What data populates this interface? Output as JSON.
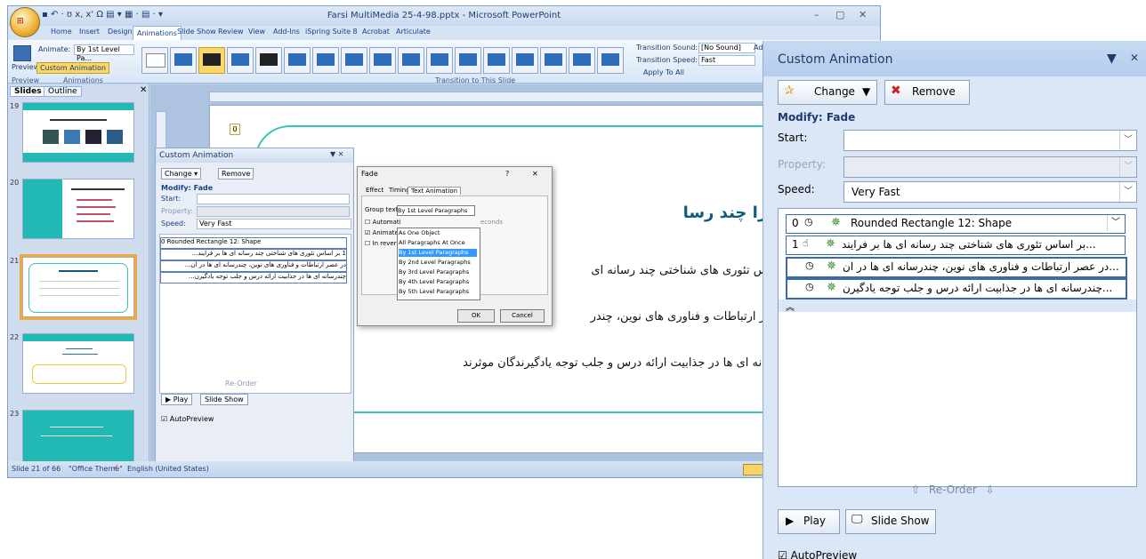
{
  "window": {
    "title": "Farsi MultiMedia 25-4-98.pptx - Microsoft PowerPoint",
    "tabs": [
      "Home",
      "Insert",
      "Design",
      "Animations",
      "Slide Show",
      "Review",
      "View",
      "Add-Ins",
      "iSpring Suite 8",
      "Acrobat",
      "Articulate"
    ],
    "active_tab": "Animations"
  },
  "ribbon": {
    "preview_label": "Preview",
    "animate_label": "Animate:",
    "animate_value": "By 1st Level Pa...",
    "custom_animation_label": "Custom Animation",
    "group_preview": "Preview",
    "group_animations": "Animations",
    "group_transition": "Transition to This Slide",
    "transition_sound_label": "Transition Sound:",
    "transition_sound_value": "[No Sound]",
    "transition_speed_label": "Transition Speed:",
    "transition_speed_value": "Fast",
    "apply_all": "Apply To All",
    "advance_short": "Adv"
  },
  "slides_pane": {
    "tab_slides": "Slides",
    "tab_outline": "Outline",
    "numbers": [
      "19",
      "20",
      "21",
      "22",
      "23"
    ]
  },
  "slide": {
    "badge": "0",
    "title": "چرا چند رسا",
    "lines": [
      "بر اساس تئوری های شناختی چند رسانه ای",
      "در عصر ارتباطات و فناوری های نوین، چندر",
      "چندرسانه ای ها در جذابیت ارائه درس و جلب توجه یادگیرندگان موثرند"
    ]
  },
  "statusbar": {
    "slide_info": "Slide 21 of 66",
    "theme": "\"Office Theme\"",
    "language": "English (United States)"
  },
  "small_pane": {
    "title": "Custom Animation",
    "change": "Change",
    "remove": "Remove",
    "modify": "Modify: Fade",
    "start": "Start:",
    "property": "Property:",
    "speed": "Speed:",
    "speed_value": "Very Fast",
    "items": [
      "0  Rounded Rectangle 12: Shape",
      "1  بر اساس تئوری های شناختی چند رسانه ای ها بر فرایند...",
      "در عصر ارتباطات و فناوری های نوین، چندرسانه ای ها در ان...",
      "چندرسانه ای ها در جذابیت ارائه درس و جلب توجه یادگیرن..."
    ],
    "reorder": "Re-Order",
    "play": "Play",
    "slide_show": "Slide Show",
    "autopreview": "AutoPreview"
  },
  "fade_dialog": {
    "title": "Fade",
    "help": "?",
    "close": "✕",
    "tabs": [
      "Effect",
      "Timing",
      "Text Animation"
    ],
    "group_text_label": "Group text:",
    "group_text_value": "By 1st Level Paragraphs",
    "autom": "Automati",
    "animate_cb": "Animate",
    "in_reverse": "In reverse",
    "seconds": "econds",
    "options": [
      "As One Object",
      "All Paragraphs At Once",
      "By 1st Level Paragraphs",
      "By 2nd Level Paragraphs",
      "By 3rd Level Paragraphs",
      "By 4th Level Paragraphs",
      "By 5th Level Paragraphs"
    ],
    "selected_index": 2,
    "ok": "OK",
    "cancel": "Cancel"
  },
  "big_pane": {
    "title": "Custom Animation",
    "change": "Change",
    "remove": "Remove",
    "modify": "Modify: Fade",
    "start_label": "Start:",
    "property_label": "Property:",
    "speed_label": "Speed:",
    "speed_value": "Very Fast",
    "items": [
      {
        "num": "0",
        "text": "Rounded Rectangle 12: Shape"
      },
      {
        "num": "1",
        "text": "...بر اساس تئوری های شناختی چند رسانه ای ها بر فرایند"
      },
      {
        "num": "",
        "text": "...در عصر ارتباطات و فناوری های نوین، چندرسانه ای ها در ان"
      },
      {
        "num": "",
        "text": "...چندرسانه ای ها در جذابیت ارائه درس و جلب توجه یادگیرن"
      }
    ],
    "reorder": "Re-Order",
    "play": "Play",
    "slide_show": "Slide Show",
    "autopreview": "AutoPreview"
  }
}
